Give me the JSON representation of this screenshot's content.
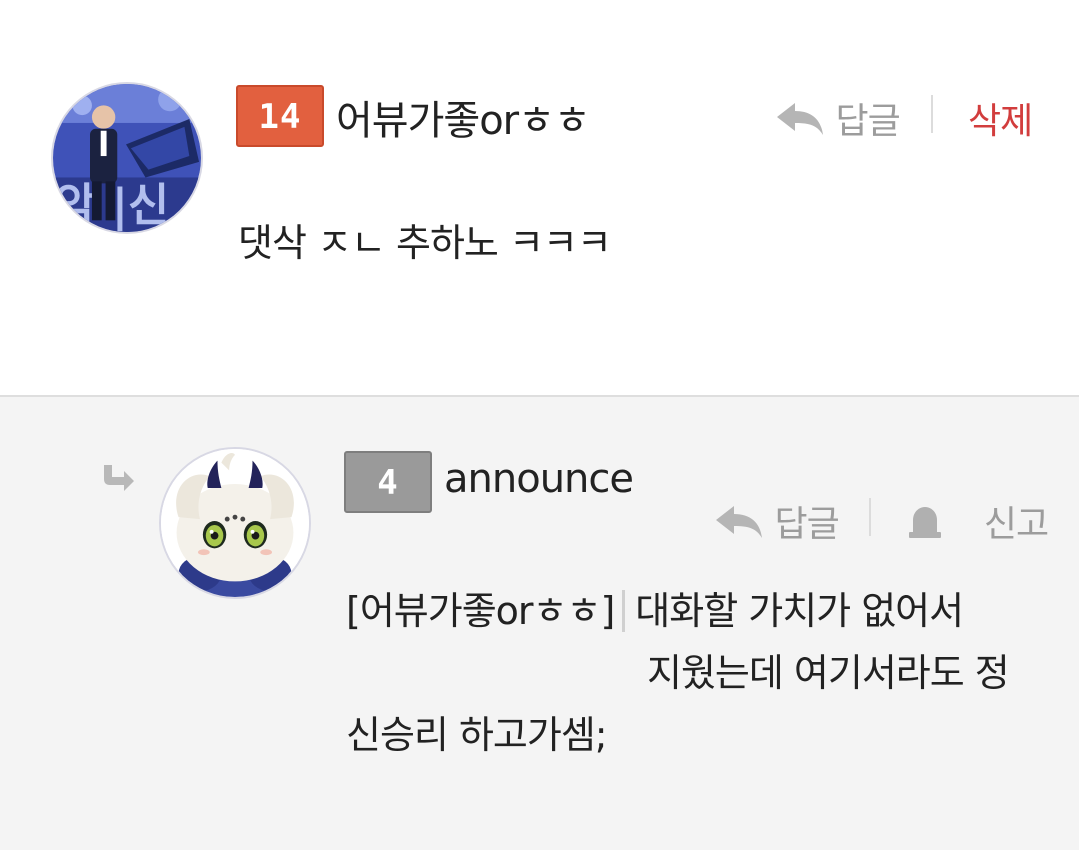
{
  "comments": [
    {
      "level": "14",
      "username": "어뷰가좋orㅎㅎ",
      "actions": {
        "reply": "답글",
        "delete": "삭제"
      },
      "body": "댓삭 ㅈㄴ 추하노 ㅋㅋㅋ"
    },
    {
      "level": "4",
      "username": "announce",
      "actions": {
        "reply": "답글",
        "report": "신고"
      },
      "quote_tag": "[어뷰가좋orㅎㅎ]",
      "body_line1": "대화할 가치가 없어서",
      "body_line2": "지웠는데 여기서라도 정",
      "body_line3": "신승리 하고가셈;"
    }
  ],
  "colors": {
    "badge_high": "#e2603f",
    "badge_low": "#9a9a9a",
    "delete": "#d23d3d",
    "action_gray": "#9c9c9c",
    "reply_bg": "#f4f4f4"
  }
}
